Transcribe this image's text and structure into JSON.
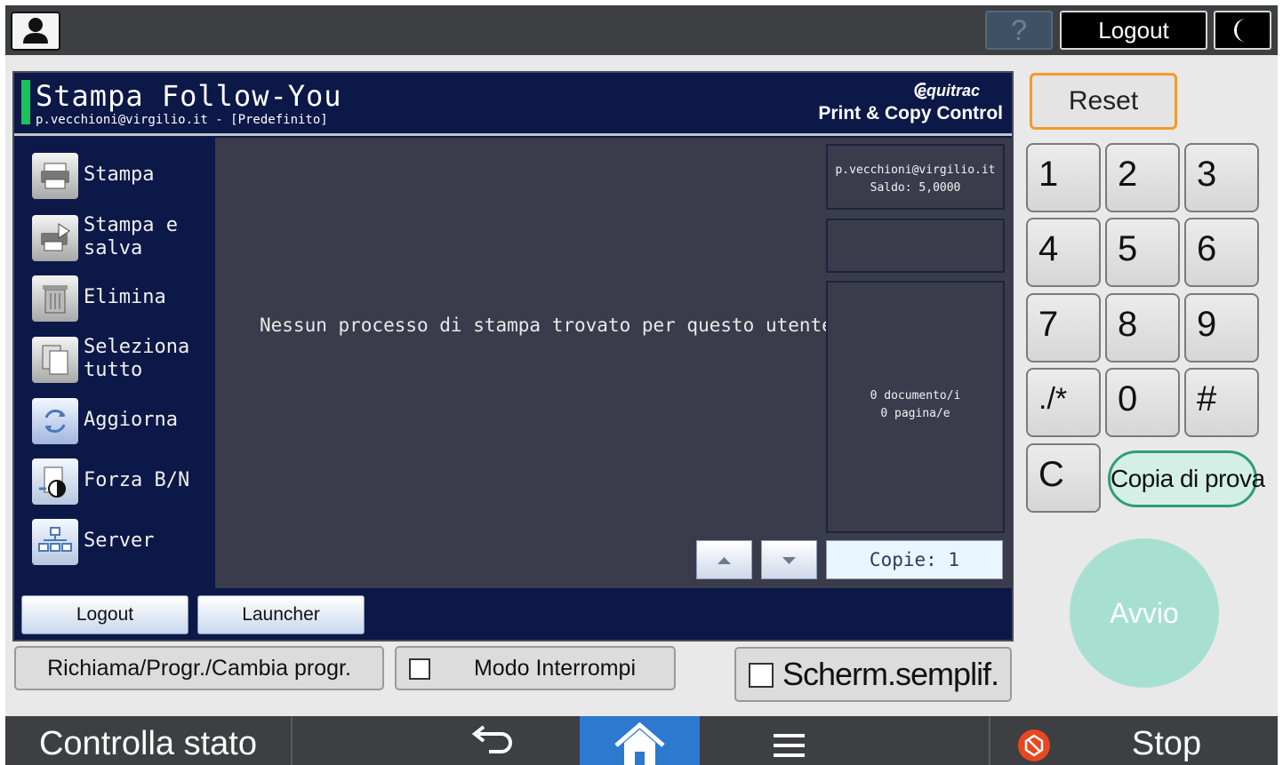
{
  "top_bar": {
    "help_label": "?",
    "logout_label": "Logout"
  },
  "app": {
    "title": "Stampa Follow-You",
    "subtitle": "p.vecchioni@virgilio.it - [Predefinito]",
    "brand": "equitrac",
    "tagline": "Print & Copy Control",
    "sidebar_items": [
      {
        "label": "Stampa",
        "icon": "printer-icon"
      },
      {
        "label": "Stampa e salva",
        "icon": "print-save-icon"
      },
      {
        "label": "Elimina",
        "icon": "trash-icon"
      },
      {
        "label": "Seleziona tutto",
        "icon": "select-all-icon"
      },
      {
        "label": "Aggiorna",
        "icon": "refresh-icon"
      },
      {
        "label": "Forza B/N",
        "icon": "force-bw-icon"
      },
      {
        "label": "Server",
        "icon": "server-icon"
      }
    ],
    "empty_message": "Nessun processo di stampa trovato per questo utente.",
    "user_info": {
      "email": "p.vecchioni@virgilio.it",
      "balance": "Saldo: 5,0000"
    },
    "documents": "0 documento/i",
    "pages": "0 pagina/e",
    "copies": "Copie: 1",
    "bottom_buttons": {
      "logout": "Logout",
      "launcher": "Launcher"
    }
  },
  "lower_row": {
    "recall_program": "Richiama/Progr./Cambia progr.",
    "interrupt_mode": "Modo Interrompi",
    "simple_screen": "Scherm.semplif."
  },
  "keypad": {
    "reset": "Reset",
    "keys": [
      "1",
      "2",
      "3",
      "4",
      "5",
      "6",
      "7",
      "8",
      "9",
      "./*",
      "0",
      "#",
      "C"
    ],
    "sample_copy": "Copia di prova",
    "start": "Avvio"
  },
  "bottom_bar": {
    "check_status": "Controlla stato",
    "stop": "Stop"
  },
  "colors": {
    "panel_bg": "#0c1847",
    "accent_green": "#18c35b",
    "reset_border": "#f39a2b",
    "start_button": "#a7e0d1",
    "home_active": "#2c79cf"
  }
}
